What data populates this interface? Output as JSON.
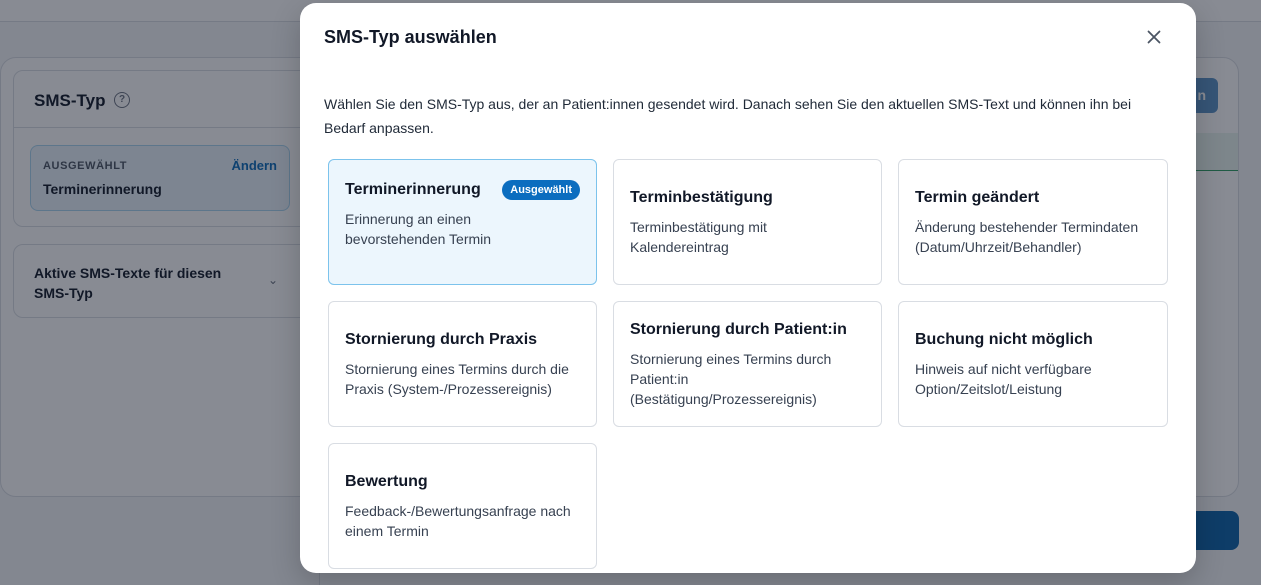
{
  "background": {
    "card_title": "SMS-Typ",
    "help_icon_glyph": "?",
    "selected_label": "AUSGEWÄHLT",
    "change_label": "Ändern",
    "selected_value": "Terminerinnerung",
    "active_texts_title": "Aktive SMS-Texte für diesen SMS-Typ",
    "chevron_glyph": "⌄",
    "partial_button_text": "n"
  },
  "modal": {
    "title": "SMS-Typ auswählen",
    "description": "Wählen Sie den SMS-Typ aus, der an Patient:innen gesendet wird. Danach sehen Sie den aktuellen SMS-Text und können ihn bei Bedarf anpassen.",
    "selected_badge": "Ausgewählt",
    "options": [
      {
        "title": "Terminerinnerung",
        "desc": "Erinnerung an einen bevorstehenden Termin",
        "selected": true
      },
      {
        "title": "Terminbestätigung",
        "desc": "Terminbestätigung mit Kalendereintrag"
      },
      {
        "title": "Termin geändert",
        "desc": "Änderung bestehender Termindaten (Datum/Uhrzeit/Behandler)"
      },
      {
        "title": "Stornierung durch Praxis",
        "desc": "Stornierung eines Termins durch die Praxis (System-/Prozessereignis)"
      },
      {
        "title": "Stornierung durch Patient:in",
        "desc": "Stornierung eines Termins durch Patient:in (Bestätigung/Prozessereignis)"
      },
      {
        "title": "Buchung nicht möglich",
        "desc": "Hinweis auf nicht verfügbare Option/Zeitslot/Leistung"
      },
      {
        "title": "Bewertung",
        "desc": "Feedback-/Bewertungsanfrage nach einem Termin"
      }
    ]
  },
  "icons": {
    "close": "close-icon",
    "help": "help-circle-icon",
    "chevron": "chevron-down-icon"
  },
  "colors": {
    "accent": "#0b6dbf",
    "selected_bg": "#ecf6fd",
    "selected_border": "#7cc3ec",
    "overlay": "rgba(17,24,39,0.5)"
  }
}
